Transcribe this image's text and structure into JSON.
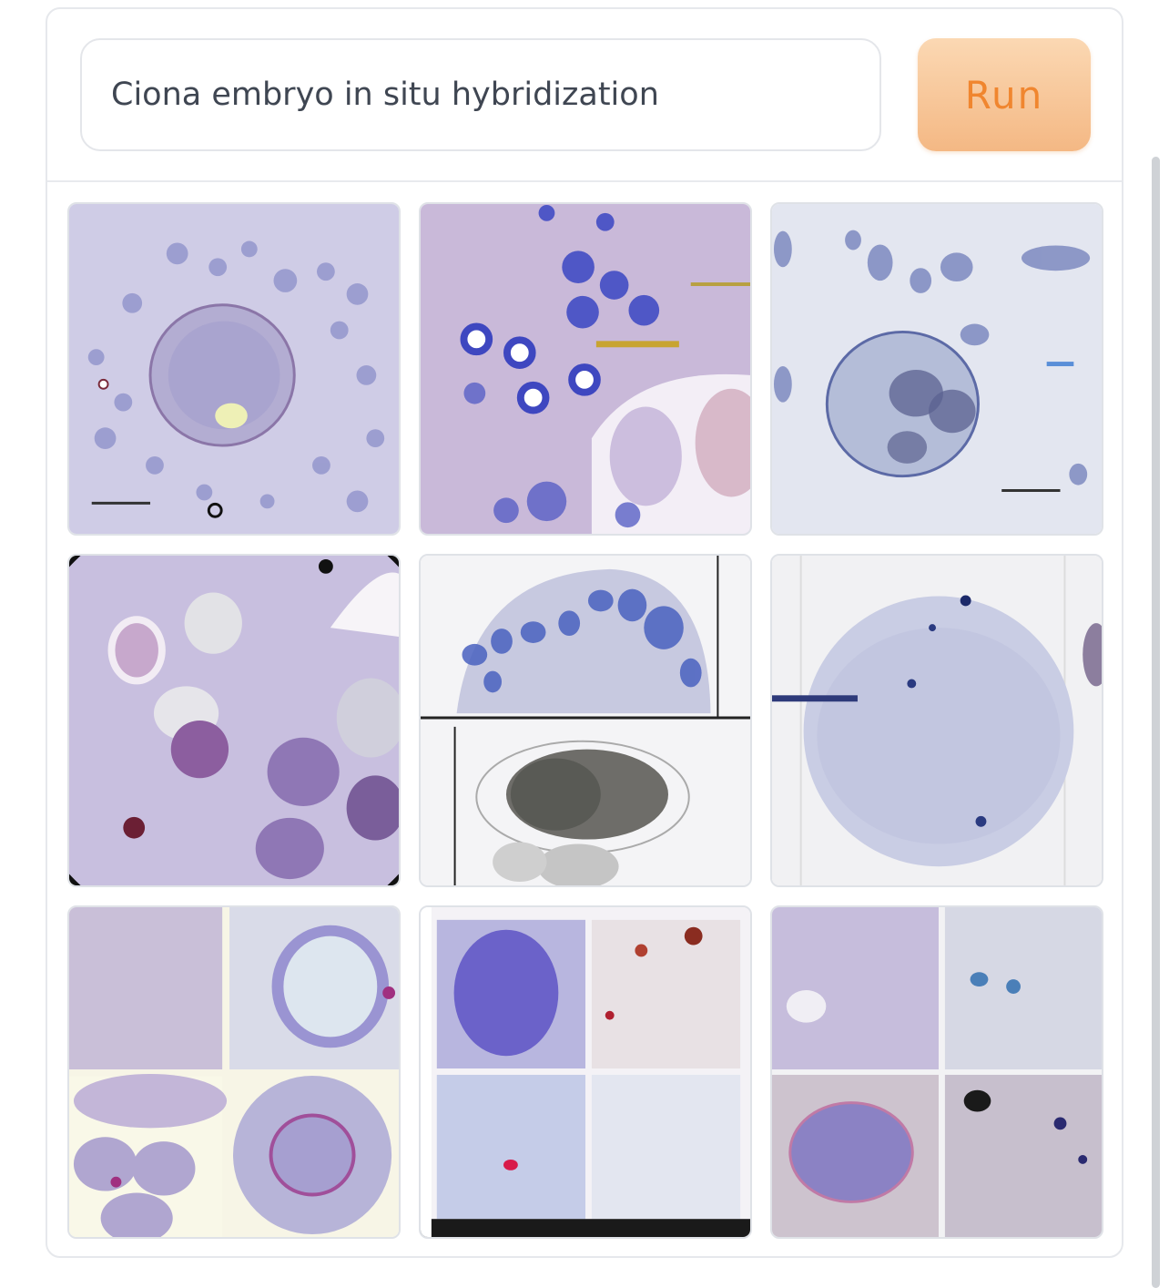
{
  "search": {
    "prompt_text": "Ciona embryo in situ hybridization"
  },
  "toolbar": {
    "run_label": "Run"
  },
  "colors": {
    "run_bg": "#f4b884",
    "run_text": "#f0862f",
    "stain_purple": "#8a7cc4",
    "stain_blue": "#3a4fb0"
  },
  "results": {
    "grid": "3x3",
    "images": [
      {
        "name": "result-image-1"
      },
      {
        "name": "result-image-2"
      },
      {
        "name": "result-image-3"
      },
      {
        "name": "result-image-4"
      },
      {
        "name": "result-image-5"
      },
      {
        "name": "result-image-6"
      },
      {
        "name": "result-image-7"
      },
      {
        "name": "result-image-8"
      },
      {
        "name": "result-image-9"
      }
    ]
  }
}
